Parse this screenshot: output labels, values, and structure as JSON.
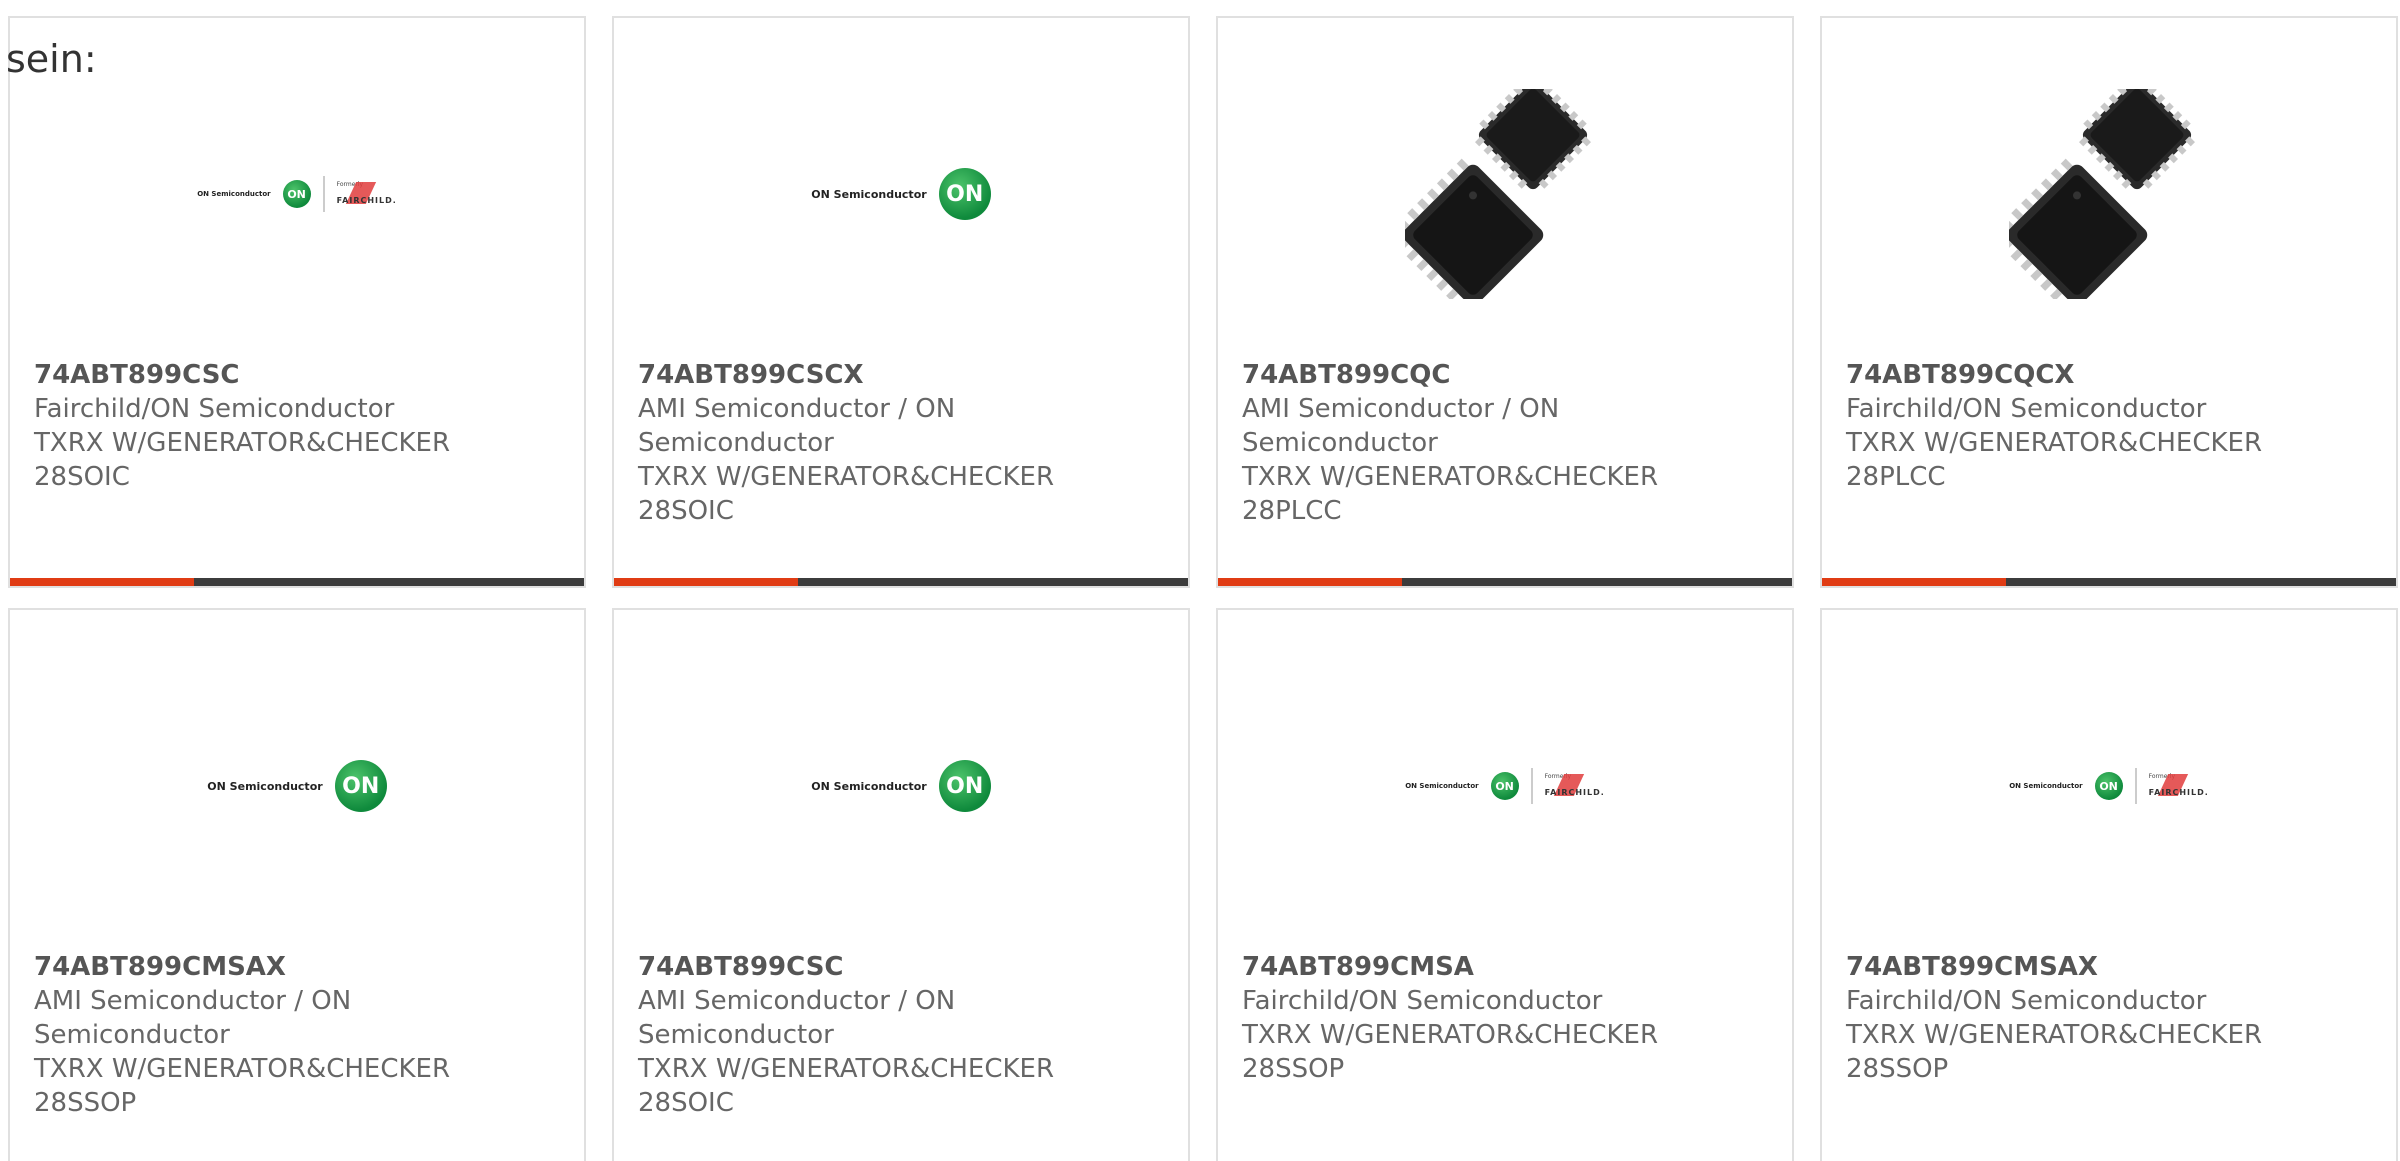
{
  "intro": {
    "text": "sein:"
  },
  "logos": {
    "on_semiconductor": "ON Semiconductor",
    "on_mark": "ON",
    "formerly": "Formerly",
    "fairchild": "FAIRCHILD."
  },
  "colors": {
    "accent": "#e03c14",
    "bar": "#3c3c3c",
    "on_green": "#0f8a3c",
    "fairchild_red": "#e03c3c"
  },
  "cards": [
    {
      "part": "74ABT899CSC",
      "manufacturer": "Fairchild/ON Semiconductor",
      "manufacturer_cont": "",
      "description": "TXRX W/GENERATOR&CHECKER",
      "package": "28SOIC",
      "image": "on-fairchild-logo"
    },
    {
      "part": "74ABT899CSCX",
      "manufacturer": "AMI Semiconductor / ON",
      "manufacturer_cont": "Semiconductor",
      "description": "TXRX W/GENERATOR&CHECKER",
      "package": "28SOIC",
      "image": "on-semiconductor-logo"
    },
    {
      "part": "74ABT899CQC",
      "manufacturer": "AMI Semiconductor / ON",
      "manufacturer_cont": "Semiconductor",
      "description": "TXRX W/GENERATOR&CHECKER",
      "package": "28PLCC",
      "image": "plcc-chip-photo"
    },
    {
      "part": "74ABT899CQCX",
      "manufacturer": "Fairchild/ON Semiconductor",
      "manufacturer_cont": "",
      "description": "TXRX W/GENERATOR&CHECKER",
      "package": "28PLCC",
      "image": "plcc-chip-photo"
    },
    {
      "part": "74ABT899CMSAX",
      "manufacturer": "AMI Semiconductor / ON",
      "manufacturer_cont": "Semiconductor",
      "description": "TXRX W/GENERATOR&CHECKER",
      "package": "28SSOP",
      "image": "on-semiconductor-logo"
    },
    {
      "part": "74ABT899CSC",
      "manufacturer": "AMI Semiconductor / ON",
      "manufacturer_cont": "Semiconductor",
      "description": "TXRX W/GENERATOR&CHECKER",
      "package": "28SOIC",
      "image": "on-semiconductor-logo"
    },
    {
      "part": "74ABT899CMSA",
      "manufacturer": "Fairchild/ON Semiconductor",
      "manufacturer_cont": "",
      "description": "TXRX W/GENERATOR&CHECKER",
      "package": "28SSOP",
      "image": "on-fairchild-logo"
    },
    {
      "part": "74ABT899CMSAX",
      "manufacturer": "Fairchild/ON Semiconductor",
      "manufacturer_cont": "",
      "description": "TXRX W/GENERATOR&CHECKER",
      "package": "28SSOP",
      "image": "on-fairchild-logo"
    }
  ]
}
